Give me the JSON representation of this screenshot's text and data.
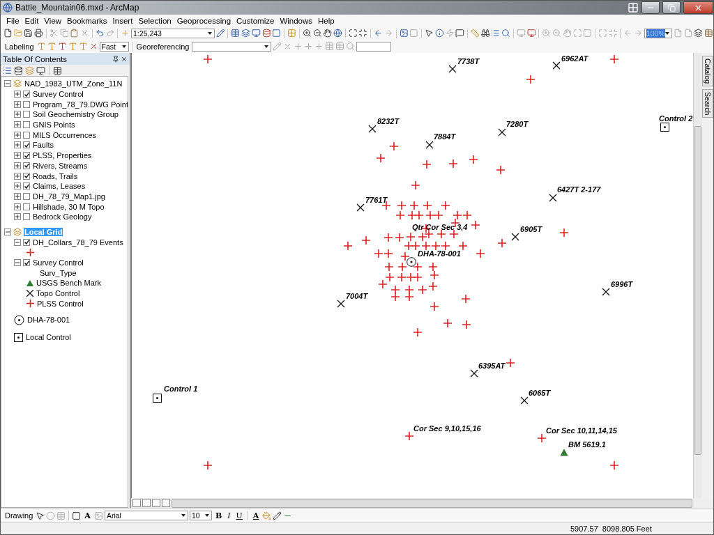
{
  "window": {
    "title": "Battle_Mountain06.mxd - ArcMap"
  },
  "menu": [
    "File",
    "Edit",
    "View",
    "Bookmarks",
    "Insert",
    "Selection",
    "Geoprocessing",
    "Customize",
    "Windows",
    "Help"
  ],
  "standard_toolbar": {
    "scale": "1:25,243"
  },
  "layout_toolbar": {
    "zoom": "100%"
  },
  "labeling_toolbar": {
    "label": "Labeling",
    "quality": "Fast"
  },
  "georeferencing_toolbar": {
    "label": "Georeferencing"
  },
  "toc": {
    "title": "Table Of Contents",
    "frames": [
      {
        "name": "NAD_1983_UTM_Zone_11N",
        "selected": false,
        "expanded": true,
        "children": [
          {
            "kind": "layer",
            "name": "Survey Control",
            "checked": true,
            "expanded": false
          },
          {
            "kind": "layer",
            "name": "Program_78_79.DWG Point",
            "checked": false,
            "expanded": false
          },
          {
            "kind": "layer",
            "name": "Soil Geochemistry Group",
            "checked": false,
            "expanded": false
          },
          {
            "kind": "layer",
            "name": "GNIS Points",
            "checked": false,
            "expanded": false
          },
          {
            "kind": "layer",
            "name": "MILS Occurrences",
            "checked": false,
            "expanded": false
          },
          {
            "kind": "layer",
            "name": "Faults",
            "checked": true,
            "expanded": false
          },
          {
            "kind": "layer",
            "name": "PLSS, Properties",
            "checked": true,
            "expanded": false
          },
          {
            "kind": "layer",
            "name": "Rivers, Streams",
            "checked": true,
            "expanded": false
          },
          {
            "kind": "layer",
            "name": "Roads, Trails",
            "checked": true,
            "expanded": false
          },
          {
            "kind": "layer",
            "name": "Claims, Leases",
            "checked": true,
            "expanded": false
          },
          {
            "kind": "layer",
            "name": "DH_78_79_Map1.jpg",
            "checked": false,
            "expanded": false
          },
          {
            "kind": "layer",
            "name": "Hillshade, 30 M Topo",
            "checked": false,
            "expanded": false
          },
          {
            "kind": "layer",
            "name": "Bedrock Geology",
            "checked": false,
            "expanded": false
          }
        ]
      },
      {
        "name": "Local Grid",
        "selected": true,
        "expanded": true,
        "children": [
          {
            "kind": "layer",
            "name": "DH_Collars_78_79 Events",
            "checked": true,
            "expanded": true,
            "legend": [
              {
                "kind": "plss"
              }
            ]
          },
          {
            "kind": "layer",
            "name": "Survey Control",
            "checked": true,
            "expanded": true,
            "legend_heading": "Surv_Type",
            "legend": [
              {
                "kind": "bench",
                "label": "USGS Bench Mark"
              },
              {
                "kind": "topo",
                "label": "Topo Control"
              },
              {
                "kind": "plss",
                "label": "PLSS Control"
              }
            ]
          },
          {
            "kind": "collar",
            "label": "DHA-78-001"
          },
          {
            "kind": "local",
            "label": "Local Control"
          }
        ]
      }
    ]
  },
  "map": {
    "features": [
      {
        "kind": "topo",
        "label": "7738T"
      },
      {
        "kind": "topo",
        "label": "6962AT"
      },
      {
        "kind": "topo",
        "label": "8232T"
      },
      {
        "kind": "topo",
        "label": "7884T"
      },
      {
        "kind": "topo",
        "label": "7280T"
      },
      {
        "kind": "local",
        "label": "Control 2"
      },
      {
        "kind": "topo",
        "label": "6427T 2-177"
      },
      {
        "kind": "topo",
        "label": "7761T"
      },
      {
        "kind": "plss",
        "label": "Qtr Cor Sec 3,4"
      },
      {
        "kind": "topo",
        "label": "6905T"
      },
      {
        "kind": "collar",
        "label": "DHA-78-001"
      },
      {
        "kind": "topo",
        "label": "6996T"
      },
      {
        "kind": "topo",
        "label": "7004T"
      },
      {
        "kind": "topo",
        "label": "6395AT"
      },
      {
        "kind": "local",
        "label": "Control 1"
      },
      {
        "kind": "topo",
        "label": "6065T"
      },
      {
        "kind": "plss",
        "label": "Cor Sec 9,10,15,16"
      },
      {
        "kind": "plss",
        "label": "Cor Sec 10,11,14,15"
      },
      {
        "kind": "bench",
        "label": "BM 5619.1"
      }
    ]
  },
  "side_tabs": [
    "Catalog",
    "Search"
  ],
  "drawing_toolbar": {
    "label": "Drawing",
    "text_tool": "A",
    "font": "Arial",
    "size": "10",
    "styles": [
      "B",
      "I",
      "U"
    ],
    "font_color": "A"
  },
  "status_bar": {
    "coordinates": "5907.57  8098.805 Feet"
  }
}
